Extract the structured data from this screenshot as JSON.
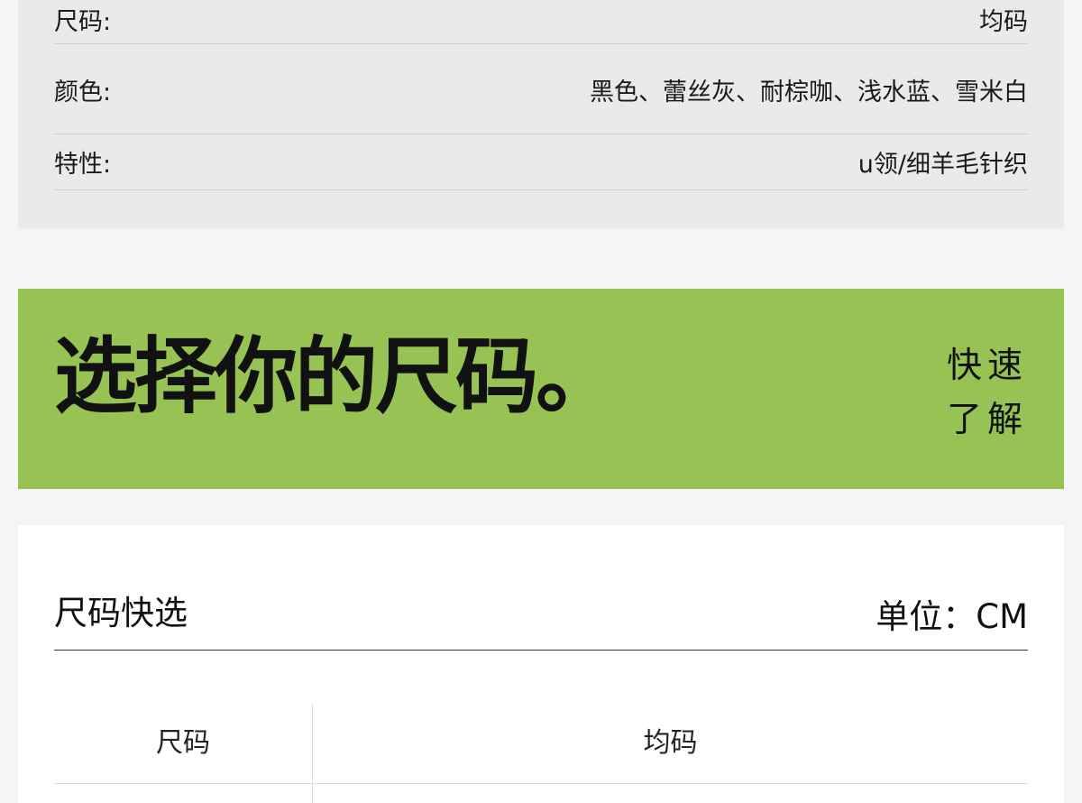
{
  "specs": {
    "rows": [
      {
        "label": "尺码:",
        "value": "均码"
      },
      {
        "label": "颜色:",
        "value": "黑色、蕾丝灰、耐棕咖、浅水蓝、雪米白"
      },
      {
        "label": "特性:",
        "value": "u领/细羊毛针织"
      }
    ]
  },
  "banner": {
    "title": "选择你的尺码。",
    "quick_line1": "快速",
    "quick_line2": "了解"
  },
  "size_card": {
    "title": "尺码快选",
    "unit": "单位：CM",
    "table": {
      "header_label": "尺码",
      "header_value": "均码"
    }
  }
}
